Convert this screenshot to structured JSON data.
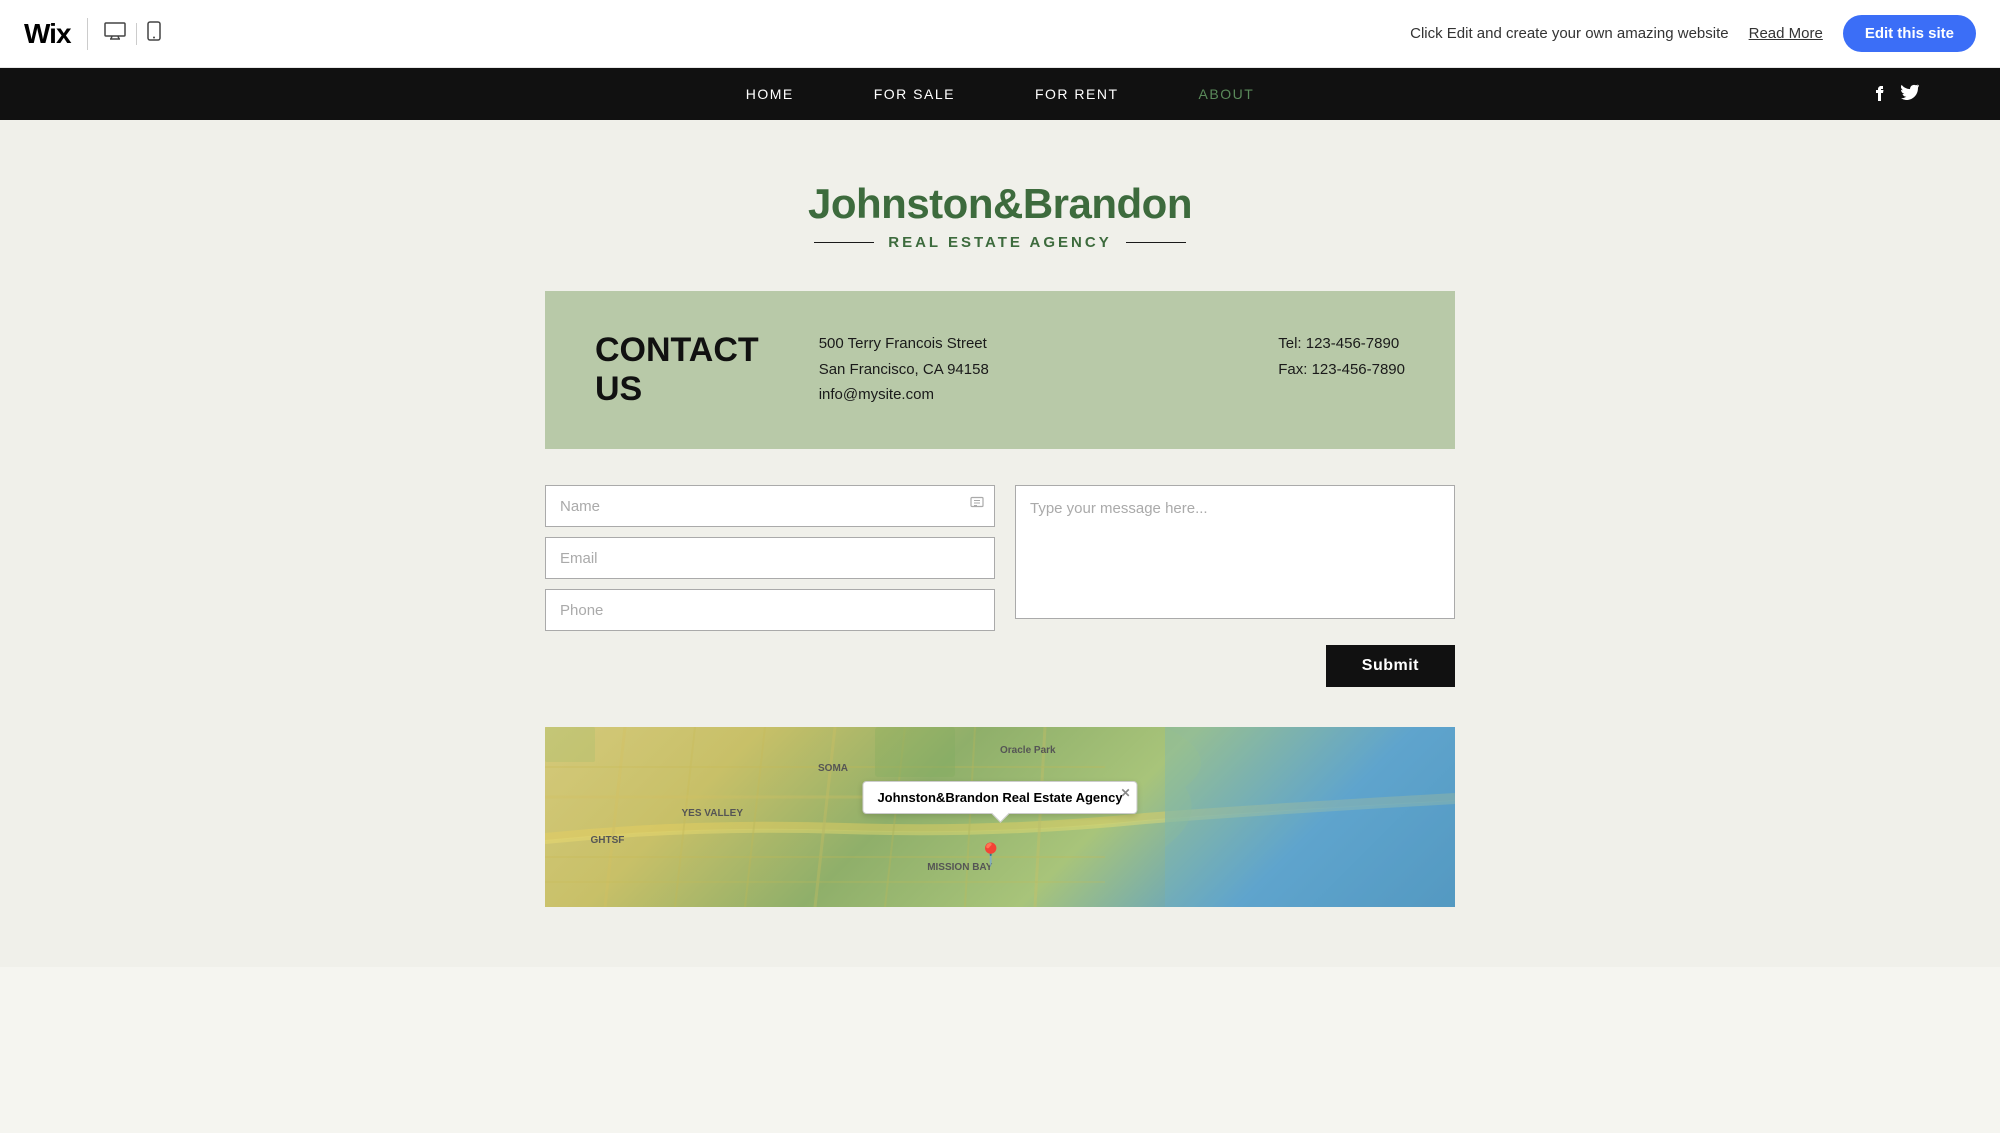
{
  "topbar": {
    "logo": "Wix",
    "promo_text": "Click Edit and create your own amazing website",
    "read_more_label": "Read More",
    "edit_site_label": "Edit this site"
  },
  "nav": {
    "items": [
      {
        "label": "HOME",
        "active": false
      },
      {
        "label": "FOR SALE",
        "active": false
      },
      {
        "label": "FOR RENT",
        "active": false
      },
      {
        "label": "ABOUT",
        "active": true
      }
    ]
  },
  "brand": {
    "name_part1": "Johnston",
    "ampersand": "&",
    "name_part2": "Brandon",
    "subtitle": "Real Estate Agency"
  },
  "contact": {
    "title_line1": "CONTACT",
    "title_line2": "US",
    "address_line1": "500 Terry Francois Street",
    "address_line2": "San Francisco, CA  94158",
    "email": "info@mysite.com",
    "tel": "Tel: 123-456-7890",
    "fax": "Fax: 123-456-7890"
  },
  "form": {
    "name_placeholder": "Name",
    "email_placeholder": "Email",
    "phone_placeholder": "Phone",
    "message_placeholder": "Type your message here...",
    "submit_label": "Submit"
  },
  "map": {
    "tooltip_text": "Johnston&Brandon Real Estate Agency"
  }
}
